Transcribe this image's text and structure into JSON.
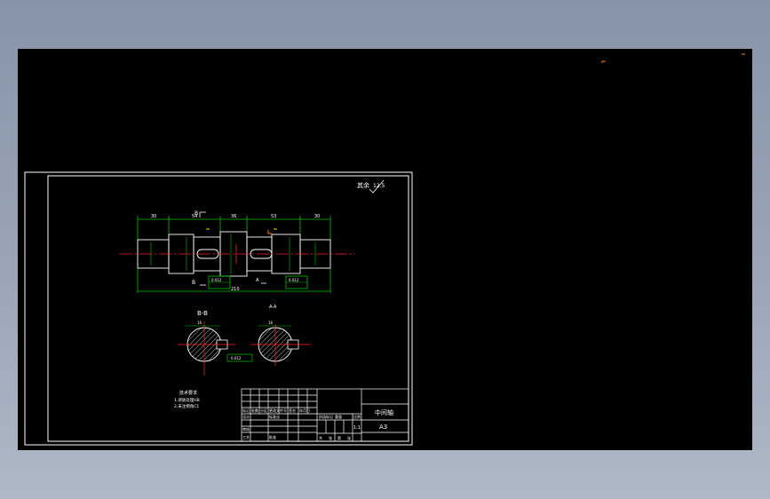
{
  "drawing": {
    "roughness_label": "其余",
    "roughness_value": "12.5",
    "section_bb": "B-B",
    "section_aa": "A-A",
    "section_marker_b": "B",
    "section_marker_a": "A",
    "dims_top": [
      "30",
      "54",
      "36",
      "53",
      "30"
    ],
    "dim_total": "210",
    "tolerance_1": "0.012",
    "tolerance_2": "0.012",
    "key_width_1": "16",
    "key_width_2": "16",
    "note_title": "技术要求",
    "note_lines": [
      "1.调质处理HB",
      "2.未注倒角C1"
    ],
    "part_name": "中间轴",
    "sheet_size": "A3",
    "title_block_scale": "1:1",
    "title_block_labels": [
      "标记",
      "处数",
      "分区",
      "更改文件号",
      "签名",
      "年月日",
      "设计",
      "标准化",
      "阶段标记",
      "重量",
      "比例",
      "审核",
      "工艺",
      "批准",
      "共",
      "张",
      "第",
      "张"
    ]
  },
  "colors": {
    "background": "#000000",
    "linework": "#ffffff",
    "dimensions": "#00c000",
    "centerline": "#ff2020",
    "accent": "#ffd000",
    "orange_mark": "#ff8000"
  }
}
